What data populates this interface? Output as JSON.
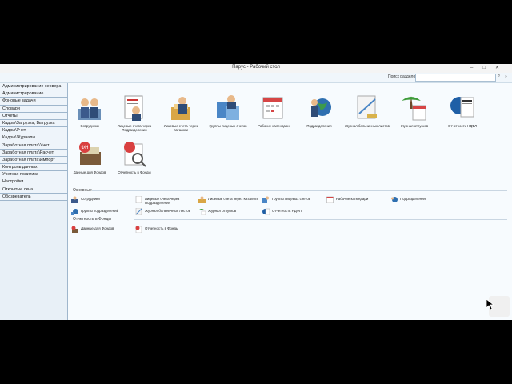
{
  "window": {
    "title": "Парус - Рабочий стол"
  },
  "search": {
    "label": "Поиск разделов",
    "value": ""
  },
  "sidebar": {
    "items": [
      "Администрирование сервера",
      "Администрирование",
      "Фоновые задачи",
      "Словари",
      "Отчеты",
      "Кадры\\Загрузка, Выгрузка",
      "Кадры\\Учет",
      "Кадры\\Журналы",
      "Заработная плата\\Учет",
      "Заработная плата\\Расчет",
      "Заработная плата\\Импорт",
      "Контроль данных",
      "Учетная политика",
      "Настройки",
      "Открытые окна",
      "Обозреватель"
    ]
  },
  "tiles": [
    {
      "label": "Сотрудники",
      "icon": "employees-icon"
    },
    {
      "label": "Лицевые счета через Подразделения",
      "icon": "accounts-departments-icon"
    },
    {
      "label": "Лицевые счета через Каталоги",
      "icon": "accounts-catalogs-icon"
    },
    {
      "label": "Группы лицевых счетов",
      "icon": "account-groups-icon"
    },
    {
      "label": "Рабочие календари",
      "icon": "work-calendars-icon"
    },
    {
      "label": "Подразделения",
      "icon": "departments-icon"
    },
    {
      "label": "Журнал больничных листов",
      "icon": "sick-leave-journal-icon"
    },
    {
      "label": "Журнал отпусков",
      "icon": "vacation-journal-icon"
    },
    {
      "label": "Отчетность НДФЛ",
      "icon": "ndfl-report-icon"
    },
    {
      "label": "Данные для Фондов",
      "icon": "fund-data-icon"
    },
    {
      "label": "Отчетность в Фонды",
      "icon": "fund-report-icon"
    }
  ],
  "sections": {
    "main": {
      "title": "Основные",
      "items": [
        "Сотрудники",
        "Лицевые счета через Подразделения",
        "Лицевые счета через Каталоги",
        "Группы лицевых счетов",
        "Рабочие календари",
        "Подразделения",
        "Группы подразделений",
        "Журнал больничных листов",
        "Журнал отпусков",
        "Отчетность НДФЛ"
      ]
    },
    "funds": {
      "title": "Отчетность в Фонды",
      "items": [
        "Данные для Фондов",
        "Отчетность в Фонды"
      ]
    }
  },
  "colors": {
    "accent": "#3a7bbf",
    "sidebar_bg": "#eef4fa",
    "main_bg": "#f7fbfe"
  }
}
